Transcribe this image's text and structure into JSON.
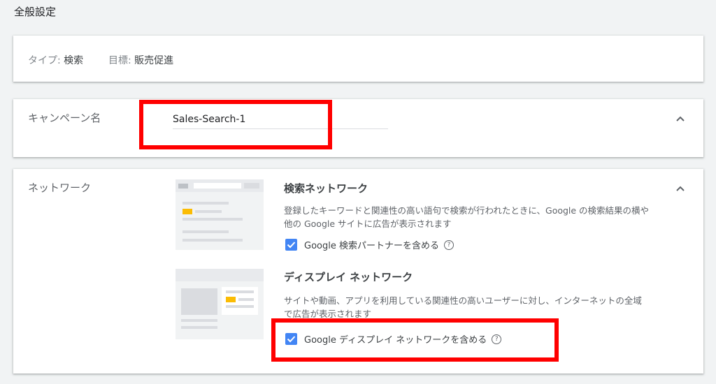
{
  "section": {
    "title": "全般設定"
  },
  "summary": {
    "type_label": "タイプ:",
    "type_value": "検索",
    "goal_label": "目標:",
    "goal_value": "販売促進"
  },
  "campaign": {
    "label": "キャンペーン名",
    "name_value": "Sales-Search-1"
  },
  "network": {
    "label": "ネットワーク",
    "search": {
      "title": "検索ネットワーク",
      "desc_line1": "登録したキーワードと関連性の高い語句で検索が行われたときに、Google の検索結果の横や",
      "desc_line2": "他の Google サイトに広告が表示されます",
      "checkbox_label": "Google 検索パートナーを含める",
      "checked": true
    },
    "display": {
      "title": "ディスプレイ ネットワーク",
      "desc_line1": "サイトや動画、アプリを利用している関連性の高いユーザーに対し、インターネットの全域",
      "desc_line2": "で広告が表示されます",
      "checkbox_label": "Google ディスプレイ ネットワークを含める",
      "checked": true
    }
  },
  "icons": {
    "collapse": "chevron-up-icon",
    "checkbox": "check-icon",
    "help": "help-circle-icon"
  },
  "colors": {
    "accent": "#4285f4",
    "highlight": "#ff0000",
    "ad_yellow": "#fbbc04"
  }
}
